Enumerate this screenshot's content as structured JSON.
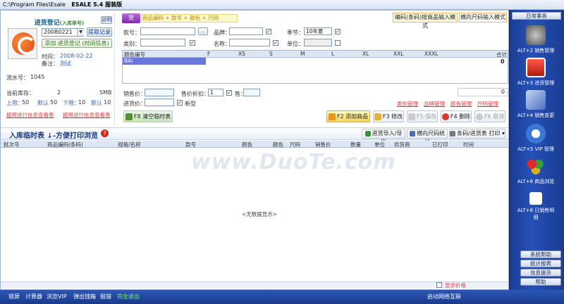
{
  "window": {
    "path": "C:\\Program Files\\Esale",
    "app_version": "ESALE 5.4 服装版"
  },
  "left_panel": {
    "title": "进货登记",
    "title_hint": "(入库单号)",
    "tag": "说明",
    "date": "20080221",
    "fetch_button": "提取记录",
    "add_button": "添加 进货登记 (时间信息)",
    "time_label": "时间：",
    "time_value": "2008-02-22",
    "remark_label": "备注：",
    "remark_value": "测试",
    "serial_label": "流水号：",
    "serial_value": "1045",
    "stock_label": "当前库存：",
    "stock_value": "2",
    "stock_unit": "SMB",
    "upper_label": "上限：",
    "upper_value": "50",
    "lower_label": "默认",
    "lower_value": "50",
    "limit2_label": "下限：",
    "limit2_value": "10",
    "lower2_label": "默认",
    "lower2_value": "10",
    "link1": "按照进行信息查看表",
    "link2": "按照进行信息查看表"
  },
  "top_tabs": {
    "icon_label": "货",
    "tags": [
      "商品编码",
      "+ 款号",
      "+ 颜色",
      "+ 尺码"
    ],
    "mode1": "编码(条码)按商品输入模式",
    "mode2": "横向尺码输入模式"
  },
  "form": {
    "code_label": "款号：",
    "brand_label": "品牌：",
    "season_label": "季节：",
    "season_value": "10年夏",
    "category_label": "类别：",
    "name_label": "名称：",
    "unit_label": "单位："
  },
  "size_grid": {
    "headers": [
      "颜色编号",
      "F",
      "XS",
      "S",
      "M",
      "L",
      "XL",
      "XXL",
      "XXXL",
      "合计"
    ],
    "row_value": "BAI",
    "total": "0"
  },
  "price_row": {
    "unit_price_label": "销售价：",
    "discount_label": "售价折扣：",
    "discount_value": "1",
    "sell_label": "售：",
    "cost_label": "进货价：",
    "cost_value": "",
    "model_label": "新型",
    "total": "0"
  },
  "manage_links": [
    "类别管理",
    "品牌管理",
    "颜色管理",
    "尺码管理"
  ],
  "toolbar": {
    "clear_button": "F8 清空临时表",
    "add_button": "F2 添加商品",
    "edit_button": "F3 修改",
    "save_button": "F5 保存",
    "delete_button": "F4 删除",
    "cancel_button": "F6 取消"
  },
  "list_header": {
    "title": "入库临时表  ↓-方便打印浏览",
    "import_button": "进货导入/导出",
    "size_stats_button": "横向尺码统计",
    "print_button": "条码/进货表 打印"
  },
  "table": {
    "columns": [
      "批次号",
      "商品编码(条码)",
      "规格/名称",
      "款号",
      "颜色",
      "颜色",
      "尺码",
      "销售价",
      "数量",
      "单位",
      "供货商",
      "已打印",
      "时间"
    ],
    "empty_text": "<无数据显示>"
  },
  "bottom_check": "显示价格",
  "right_panel": {
    "header": "日常事务",
    "items": [
      {
        "key": "ALT+2",
        "label": "销售管理"
      },
      {
        "key": "ALT+3",
        "label": "进货管理"
      },
      {
        "key": "ALT+4",
        "label": "销售变更"
      },
      {
        "key": "ALT+5",
        "label": "VIP 管理"
      },
      {
        "key": "ALT+6",
        "label": "商品浏览"
      },
      {
        "key": "ALT+8",
        "label": "日销售明细"
      }
    ],
    "small_buttons": [
      "系统帮助",
      "统计报表",
      "信息提示",
      "帮助"
    ]
  },
  "statusbar": {
    "items": [
      "锁屏",
      "计算器",
      "浏览VIP",
      "弹出钱箱",
      "报错",
      "完全退出"
    ],
    "right_text": "启动网络互联"
  },
  "watermark": "www.DuoTe.com"
}
